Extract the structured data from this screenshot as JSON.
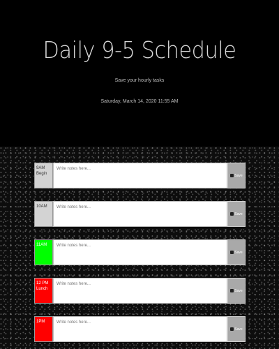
{
  "header": {
    "title": "Daily 9-5 Schedule",
    "subtitle": "Save your hourly tasks",
    "datetime": "Saturday, March 14, 2020 11:55 AM"
  },
  "colors": {
    "past": "#d3d3d3",
    "present": "#00ff00",
    "future": "#ff0000",
    "save_button": "#a9a9a9"
  },
  "rows": [
    {
      "hour": "9AM Begin",
      "state": "past",
      "placeholder": "Write notes here...",
      "save_label": "Save",
      "icon": "save-icon"
    },
    {
      "hour": "10AM",
      "state": "past",
      "placeholder": "Write notes here...",
      "save_label": "Save",
      "icon": "save-icon"
    },
    {
      "hour": "11AM",
      "state": "present",
      "placeholder": "Write notes here...",
      "save_label": "Save",
      "icon": "save-icon"
    },
    {
      "hour": "12 PM Lunch",
      "state": "future",
      "placeholder": "Write notes here...",
      "save_label": "Save",
      "icon": "save-icon"
    },
    {
      "hour": "1PM",
      "state": "future",
      "placeholder": "Write notes here...",
      "save_label": "Save",
      "icon": "save-icon"
    }
  ]
}
